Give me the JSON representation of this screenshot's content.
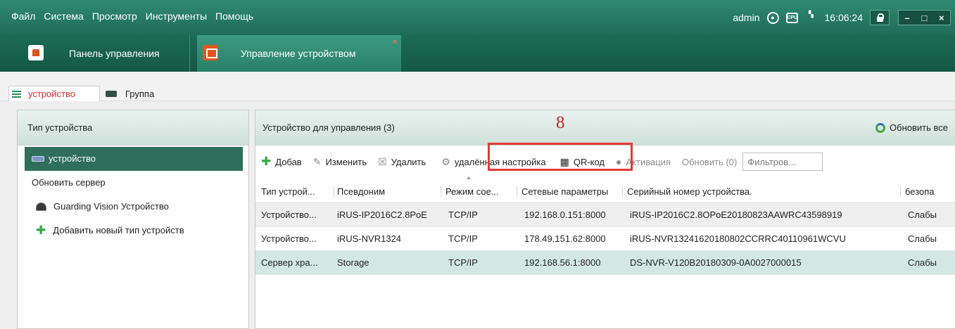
{
  "menubar": {
    "items": [
      "Файл",
      "Система",
      "Просмотр",
      "Инструменты",
      "Помощь"
    ],
    "user": "admin",
    "cpu_label": "CPU",
    "time": "16:06:24",
    "window_controls": [
      "–",
      "□",
      "×"
    ]
  },
  "tabs": [
    {
      "label": "Панель управления"
    },
    {
      "label": "Управление устройством"
    }
  ],
  "subtabs": [
    {
      "label": "устройство"
    },
    {
      "label": "Группа"
    }
  ],
  "left_panel": {
    "title": "Тип устройства",
    "items": [
      {
        "label": "устройство"
      },
      {
        "label": "Обновить сервер"
      },
      {
        "label": "Guarding Vision Устройство"
      },
      {
        "label": "Добавить новый тип устройств"
      }
    ]
  },
  "right_panel": {
    "title": "Устройство для управления (3)",
    "refresh_all": "Обновить все",
    "annotation": "8",
    "toolbar": {
      "add": "Добав",
      "edit": "Изменить",
      "delete": "Удалить",
      "remote_config": "удалённая настройка",
      "qr": "QR-код",
      "activate": "Активация",
      "refresh": "Обновить (0)",
      "filter_placeholder": "Фильтров..."
    },
    "columns": [
      "Тип устрой...",
      "Псевдоним",
      "Режим сое...",
      "Сетевые параметры",
      "Серийный номер устройства.",
      "безопа"
    ],
    "rows": [
      [
        "Устройство...",
        "iRUS-IP2016C2.8PoE",
        "TCP/IP",
        "192.168.0.151:8000",
        "iRUS-IP2016C2.8OPoE20180823AAWRC43598919",
        "Слабы"
      ],
      [
        "Устройство...",
        "iRUS-NVR1324",
        "TCP/IP",
        "178.49.151.62:8000",
        "iRUS-NVR13241620180802CCRRC40110961WCVU",
        "Слабы"
      ],
      [
        "Сервер хра...",
        "Storage",
        "TCP/IP",
        "192.168.56.1:8000",
        "DS-NVR-V120B20180309-0A0027000015",
        "Слабы"
      ]
    ]
  }
}
